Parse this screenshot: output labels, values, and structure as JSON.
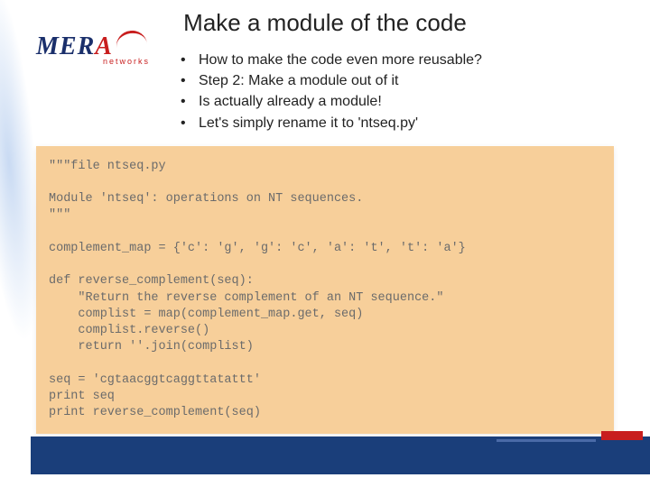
{
  "title": "Make a module of the code",
  "logo": {
    "word_pre": "MER",
    "word_red": "A",
    "sub": "networks"
  },
  "bullets": [
    "How to make the code even more reusable?",
    "Step 2: Make a module out of it",
    "Is actually already a module!",
    "Let's simply rename it to 'ntseq.py'"
  ],
  "code": "\"\"\"file ntseq.py\n\nModule 'ntseq': operations on NT sequences.\n\"\"\"\n\ncomplement_map = {'c': 'g', 'g': 'c', 'a': 't', 't': 'a'}\n\ndef reverse_complement(seq):\n    \"Return the reverse complement of an NT sequence.\"\n    complist = map(complement_map.get, seq)\n    complist.reverse()\n    return ''.join(complist)\n\nseq = 'cgtaacggtcaggttatattt'\nprint seq\nprint reverse_complement(seq)"
}
